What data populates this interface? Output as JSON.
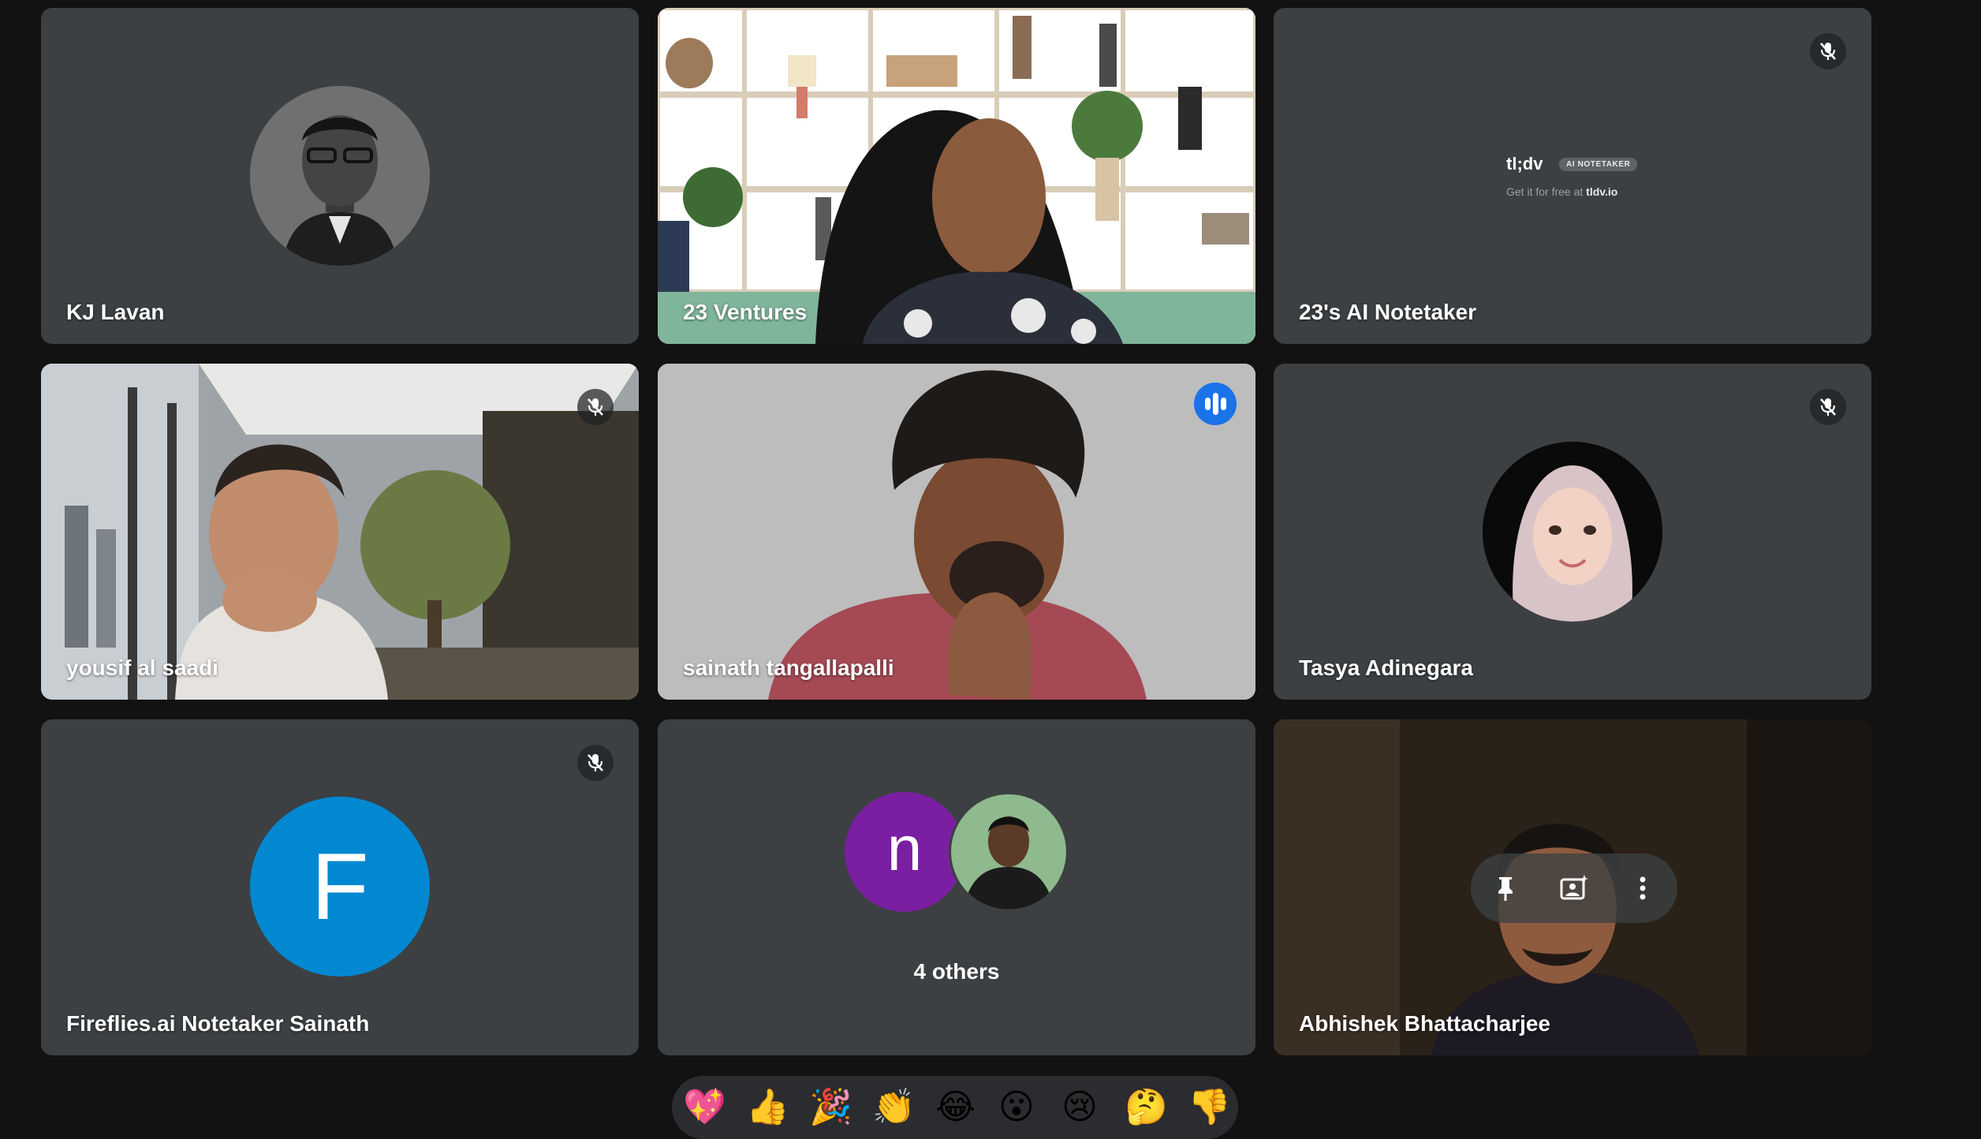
{
  "tiles": [
    {
      "name": "KJ Lavan",
      "muted": false,
      "kind": "avatar"
    },
    {
      "name": "23 Ventures",
      "muted": false,
      "kind": "video"
    },
    {
      "name": "23's AI Notetaker",
      "muted": true,
      "kind": "bot"
    },
    {
      "name": "yousif al saadi",
      "muted": true,
      "kind": "video"
    },
    {
      "name": "sainath tangallapalli",
      "muted": false,
      "kind": "video",
      "speaking": true
    },
    {
      "name": "Tasya Adinegara",
      "muted": true,
      "kind": "avatar"
    },
    {
      "name": "Fireflies.ai Notetaker Sainath",
      "muted": true,
      "kind": "letter",
      "letter": "F"
    },
    {
      "name": "4 others",
      "kind": "group",
      "letter": "n"
    },
    {
      "name": "Abhishek Bhattacharjee",
      "muted": false,
      "kind": "video"
    }
  ],
  "tldv": {
    "logo": "tl;dv",
    "badge": "AI NOTETAKER",
    "sub_prefix": "Get it for free at",
    "sub_link": "tldv.io"
  },
  "hover_controls": [
    "pin-icon",
    "visual-effects-icon",
    "more-options-icon"
  ],
  "reactions": [
    "💖",
    "👍",
    "🎉",
    "👏",
    "😂",
    "😮",
    "😢",
    "🤔",
    "👎"
  ],
  "colors": {
    "tile_bg": "#3c4043",
    "speaking_accent": "#1a73e8",
    "active_outline": "#8ab4f8",
    "fireflies_avatar": "#0288d1",
    "group_avatar": "#7b1fa2"
  }
}
